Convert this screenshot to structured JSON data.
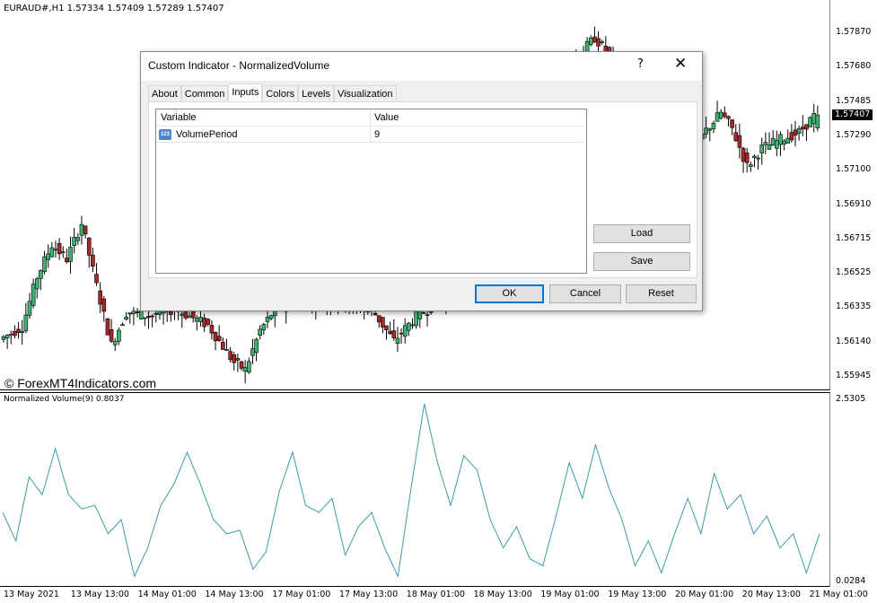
{
  "chart": {
    "symbol_line": "EURAUD#,H1  1.57334 1.57409 1.57289 1.57407",
    "watermark": "© ForexMT4Indicators.com",
    "price_axis": [
      "1.57870",
      "1.57680",
      "1.57485",
      "1.57290",
      "1.57100",
      "1.56910",
      "1.56715",
      "1.56525",
      "1.56335",
      "1.56140",
      "1.55945"
    ],
    "current_price": "1.57407",
    "price_range": [
      1.55945,
      1.5787
    ],
    "bull_color": "#3cb371",
    "bear_color": "#a52a2a",
    "price_anchors": [
      [
        0,
        1.5615
      ],
      [
        6,
        1.5622
      ],
      [
        10,
        1.565
      ],
      [
        14,
        1.5668
      ],
      [
        18,
        1.566
      ],
      [
        22,
        1.568
      ],
      [
        26,
        1.5645
      ],
      [
        30,
        1.5612
      ],
      [
        34,
        1.563
      ],
      [
        40,
        1.5628
      ],
      [
        47,
        1.5632
      ],
      [
        56,
        1.5623
      ],
      [
        63,
        1.5602
      ],
      [
        66,
        1.5598
      ],
      [
        70,
        1.562
      ],
      [
        74,
        1.5632
      ],
      [
        80,
        1.5636
      ],
      [
        88,
        1.5636
      ],
      [
        100,
        1.5632
      ],
      [
        106,
        1.5614
      ],
      [
        112,
        1.5628
      ],
      [
        120,
        1.5638
      ],
      [
        135,
        1.57
      ],
      [
        150,
        1.576
      ],
      [
        160,
        1.5784
      ],
      [
        170,
        1.576
      ],
      [
        180,
        1.5735
      ],
      [
        186,
        1.572
      ],
      [
        190,
        1.5732
      ],
      [
        194,
        1.5742
      ],
      [
        197,
        1.5733
      ],
      [
        201,
        1.5712
      ],
      [
        205,
        1.5722
      ],
      [
        210,
        1.5727
      ],
      [
        215,
        1.5731
      ],
      [
        219,
        1.574
      ],
      [
        220,
        1.57407
      ]
    ],
    "visible_bars": 220
  },
  "indicator": {
    "label": "Normalized Volume(9) 0.8037",
    "axis_max": "2.5305",
    "axis_min": "0.0284",
    "range": [
      0.0284,
      2.5305
    ],
    "line_color": "#3a9ca8",
    "anchors": [
      [
        0,
        1.0
      ],
      [
        4,
        0.6
      ],
      [
        8,
        1.5
      ],
      [
        12,
        1.25
      ],
      [
        16,
        1.9
      ],
      [
        20,
        1.25
      ],
      [
        24,
        1.05
      ],
      [
        28,
        1.1
      ],
      [
        32,
        0.7
      ],
      [
        36,
        0.9
      ],
      [
        40,
        0.1
      ],
      [
        44,
        0.5
      ],
      [
        48,
        1.1
      ],
      [
        52,
        1.4
      ],
      [
        56,
        1.85
      ],
      [
        60,
        1.4
      ],
      [
        64,
        0.9
      ],
      [
        68,
        0.7
      ],
      [
        72,
        0.75
      ],
      [
        76,
        0.2
      ],
      [
        80,
        0.45
      ],
      [
        84,
        1.3
      ],
      [
        88,
        1.85
      ],
      [
        92,
        1.1
      ],
      [
        96,
        1.0
      ],
      [
        100,
        1.2
      ],
      [
        104,
        0.4
      ],
      [
        108,
        0.8
      ],
      [
        112,
        1.0
      ],
      [
        116,
        0.5
      ],
      [
        120,
        0.1
      ],
      [
        124,
        1.35
      ],
      [
        128,
        2.53
      ],
      [
        132,
        1.7
      ],
      [
        136,
        1.1
      ],
      [
        140,
        1.8
      ],
      [
        144,
        1.6
      ],
      [
        148,
        0.9
      ],
      [
        152,
        0.5
      ],
      [
        156,
        0.8
      ],
      [
        160,
        0.35
      ],
      [
        164,
        0.25
      ],
      [
        168,
        0.95
      ],
      [
        172,
        1.7
      ],
      [
        176,
        1.2
      ],
      [
        180,
        1.95
      ],
      [
        184,
        1.35
      ],
      [
        188,
        0.9
      ],
      [
        192,
        0.25
      ],
      [
        196,
        0.6
      ],
      [
        200,
        0.15
      ],
      [
        204,
        0.7
      ],
      [
        208,
        1.2
      ],
      [
        212,
        0.7
      ],
      [
        216,
        1.55
      ],
      [
        220,
        1.05
      ],
      [
        224,
        1.25
      ],
      [
        228,
        0.7
      ],
      [
        232,
        0.95
      ],
      [
        236,
        0.5
      ],
      [
        240,
        0.7
      ],
      [
        244,
        0.15
      ],
      [
        248,
        0.7
      ]
    ],
    "bars": 248
  },
  "time_axis": [
    "13 May 2021",
    "13 May 13:00",
    "14 May 01:00",
    "14 May 13:00",
    "17 May 01:00",
    "17 May 13:00",
    "18 May 01:00",
    "18 May 13:00",
    "19 May 01:00",
    "19 May 13:00",
    "20 May 01:00",
    "20 May 13:00",
    "21 May 01:00"
  ],
  "dialog": {
    "title": "Custom Indicator - NormalizedVolume",
    "help": "?",
    "close": "✕",
    "tabs": [
      "About",
      "Common",
      "Inputs",
      "Colors",
      "Levels",
      "Visualization"
    ],
    "active_tab": "Inputs",
    "columns": [
      "Variable",
      "Value"
    ],
    "rows": [
      {
        "icon": "123",
        "variable": "VolumePeriod",
        "value": "9"
      }
    ],
    "buttons": {
      "load": "Load",
      "save": "Save",
      "ok": "OK",
      "cancel": "Cancel",
      "reset": "Reset"
    }
  }
}
